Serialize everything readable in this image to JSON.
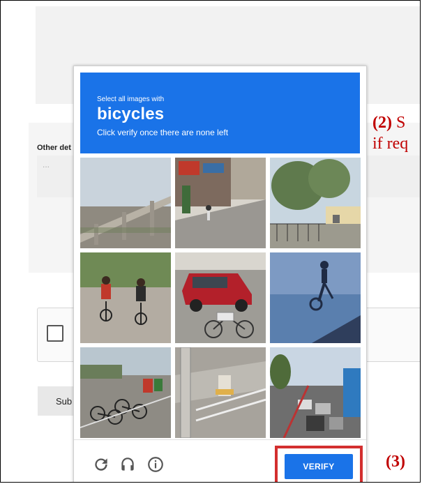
{
  "form": {
    "other_label": "Other det",
    "placeholder": "...",
    "submit_label": "Sub"
  },
  "annotations": {
    "step2_num": "(2)",
    "step2_line1": " S",
    "step2_line2": "if req",
    "step3": "(3)"
  },
  "captcha": {
    "instruction": "Select all images with",
    "target": "bicycles",
    "note": "Click verify once there are none left",
    "tiles": [
      "elevated highway overpass",
      "street with shops and a cyclist",
      "trees and a building behind a fence",
      "two children riding bicycles",
      "parked red car and bicycle",
      "shadow of a person on a bicycle",
      "bicycles parked near a street",
      "pole and fire hydrant on sidewalk",
      "busy street with traffic"
    ],
    "verify_label": "VERIFY",
    "icons": [
      "reload-icon",
      "audio-icon",
      "info-icon"
    ],
    "accent_color": "#1a73e8",
    "highlight_color": "#d32f2f"
  }
}
